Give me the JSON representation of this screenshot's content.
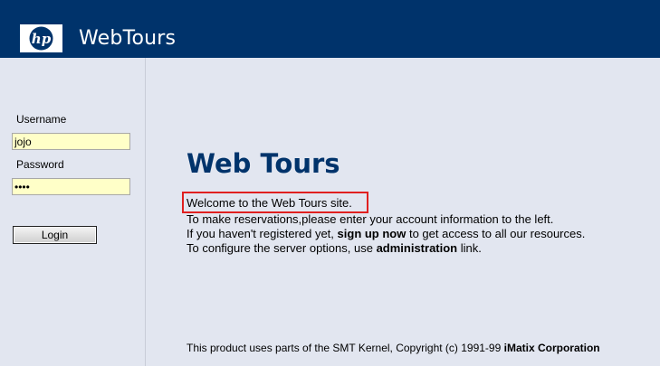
{
  "header": {
    "logo_text": "hp",
    "app_title": "WebTours",
    "brand_color": "#00336b"
  },
  "login": {
    "username_label": "Username",
    "username_value": "jojo",
    "password_label": "Password",
    "password_value": "••••",
    "login_button": "Login"
  },
  "main": {
    "title": "Web Tours",
    "welcome": "Welcome to the Web Tours site.",
    "line2": "To make reservations,please enter your account information to the left.",
    "line3_pre": "If you haven't registered yet, ",
    "line3_link": "sign up now",
    "line3_post": " to get access to all our resources.",
    "line4_pre": "To configure the server options, use ",
    "line4_link": "administration",
    "line4_post": " link."
  },
  "footer": {
    "text": "This product uses parts of the SMT Kernel, Copyright (c) 1991-99 ",
    "company": "iMatix Corporation"
  }
}
